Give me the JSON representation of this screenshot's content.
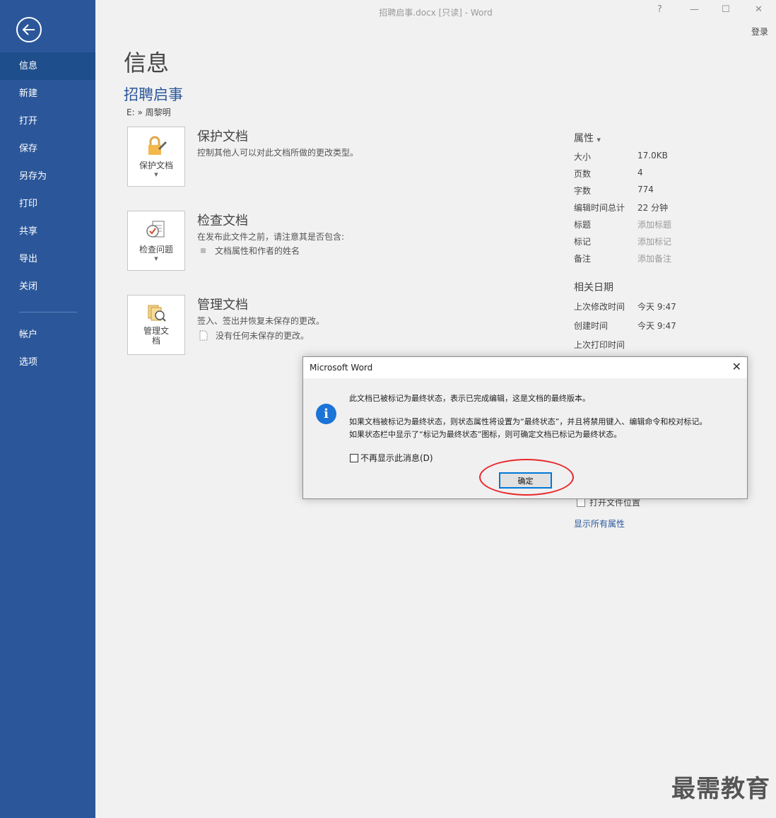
{
  "window": {
    "title": "招聘启事.docx [只读] - Word",
    "help": "?",
    "minimize": "—",
    "maximize": "☐",
    "close": "✕",
    "login": "登录"
  },
  "sidebar": {
    "items": [
      {
        "label": "信息"
      },
      {
        "label": "新建"
      },
      {
        "label": "打开"
      },
      {
        "label": "保存"
      },
      {
        "label": "另存为"
      },
      {
        "label": "打印"
      },
      {
        "label": "共享"
      },
      {
        "label": "导出"
      },
      {
        "label": "关闭"
      },
      {
        "label": "帐户"
      },
      {
        "label": "选项"
      }
    ]
  },
  "main": {
    "page_title": "信息",
    "doc_title": "招聘启事",
    "doc_path": "E: » 周黎明",
    "sections": [
      {
        "button": "保护文档",
        "heading": "保护文档",
        "desc": "控制其他人可以对此文档所做的更改类型。"
      },
      {
        "button": "检查问题",
        "heading": "检查文档",
        "desc": "在发布此文件之前，请注意其是否包含:",
        "bullet": "文档属性和作者的姓名"
      },
      {
        "button": "管理文档",
        "heading": "管理文档",
        "desc": "签入、签出并恢复未保存的更改。",
        "bullet": "没有任何未保存的更改。"
      }
    ]
  },
  "properties": {
    "heading": "属性",
    "rows": [
      {
        "k": "大小",
        "v": "17.0KB"
      },
      {
        "k": "页数",
        "v": "4"
      },
      {
        "k": "字数",
        "v": "774"
      },
      {
        "k": "编辑时间总计",
        "v": "22 分钟"
      },
      {
        "k": "标题",
        "v": "添加标题"
      },
      {
        "k": "标记",
        "v": "添加标记"
      },
      {
        "k": "备注",
        "v": "添加备注"
      }
    ],
    "dates_heading": "相关日期",
    "dates": [
      {
        "k": "上次修改时间",
        "v": "今天 9:47"
      },
      {
        "k": "创建时间",
        "v": "今天 9:47"
      },
      {
        "k": "上次打印时间",
        "v": ""
      }
    ],
    "open_location": "打开文件位置",
    "show_all": "显示所有属性"
  },
  "dialog": {
    "title": "Microsoft Word",
    "line1": "此文档已被标记为最终状态，表示已完成编辑，这是文档的最终版本。",
    "line2": "如果文档被标记为最终状态，则状态属性将设置为“最终状态”，并且将禁用键入、编辑命令和校对标记。",
    "line3": "如果状态栏中显示了“标记为最终状态”图标，则可确定文档已标记为最终状态。",
    "checkbox": "不再显示此消息(D)",
    "ok": "确定"
  },
  "watermark": "最需教育",
  "colors": {
    "sidebar": "#2b579a",
    "accent": "#2b579a",
    "annotation": "#e8282c"
  }
}
